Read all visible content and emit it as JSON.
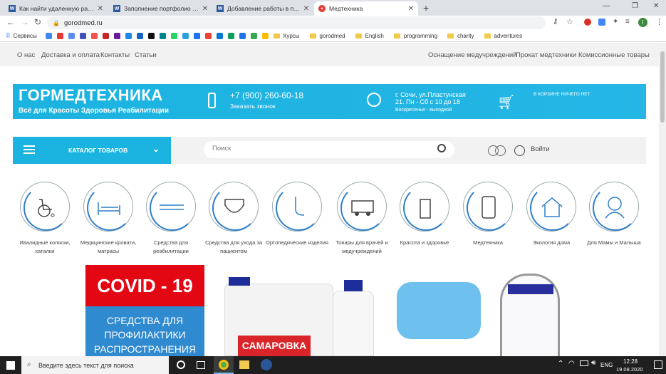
{
  "browser": {
    "tabs": [
      {
        "title": "Как найти удаленную работу –",
        "icon": "word-icon",
        "active": false
      },
      {
        "title": "Заполнение портфолио фрила",
        "icon": "word-icon",
        "active": false
      },
      {
        "title": "Добавление работы в портфол",
        "icon": "word-icon",
        "active": false
      },
      {
        "title": "Медтехника",
        "icon": "site-icon",
        "active": true
      }
    ],
    "new_tab_label": "+",
    "url": "gorodmed.ru",
    "bookmarks_label": "Сервисы",
    "bookmark_folders": [
      "Курсы",
      "gorodmed",
      "English",
      "programming",
      "charity",
      "adventures"
    ],
    "profile_initial": "I"
  },
  "site": {
    "top_links": [
      "О нас",
      "Доставка и оплата",
      "Контакты",
      "Статьи"
    ],
    "right_links": [
      "Оснащение медучреждений",
      "Прокат медтехники",
      "Комиссионные товары"
    ],
    "logo_title": "ГОРМЕДТЕХНИКА",
    "logo_subtitle": "Всё для Красоты Здоровья Реабилитации",
    "phone": "+7 (900) 260-60-18",
    "callback": "Заказать звонок",
    "address": "г. Сочи, ул.Пластунская",
    "hours": "21. Пн - Сб с 10 до 18",
    "dayoff": "Воскресенье - выходной",
    "cart": "В КОРЗИНЕ НИЧЕГО НЕТ",
    "catalog_btn": "КАТАЛОГ ТОВАРОВ",
    "search_placeholder": "Поиск",
    "login": "Войти",
    "categories": [
      "Ивалидные коляски, каталки",
      "Медицинские кровати, матрасы",
      "Средства для реабилитации",
      "Средства для ухода за пациентом",
      "Ортопедические изделия",
      "Товары для врачей и медучреждений",
      "Красота и здоровье",
      "Медтехника",
      "Экология дома",
      "Для Мамы и Малыша"
    ],
    "promo": {
      "title": "COVID - 19",
      "text": "СРЕДСТВА ДЛЯ ПРОФИЛАКТИКИ РАСПРОСТРАНЕНИЯ",
      "product_label": "САМАРОВКА"
    }
  },
  "taskbar": {
    "search_placeholder": "Введите здесь текст для поиска",
    "lang": "ENG",
    "time": "12:28",
    "date": "19.08.2020"
  }
}
